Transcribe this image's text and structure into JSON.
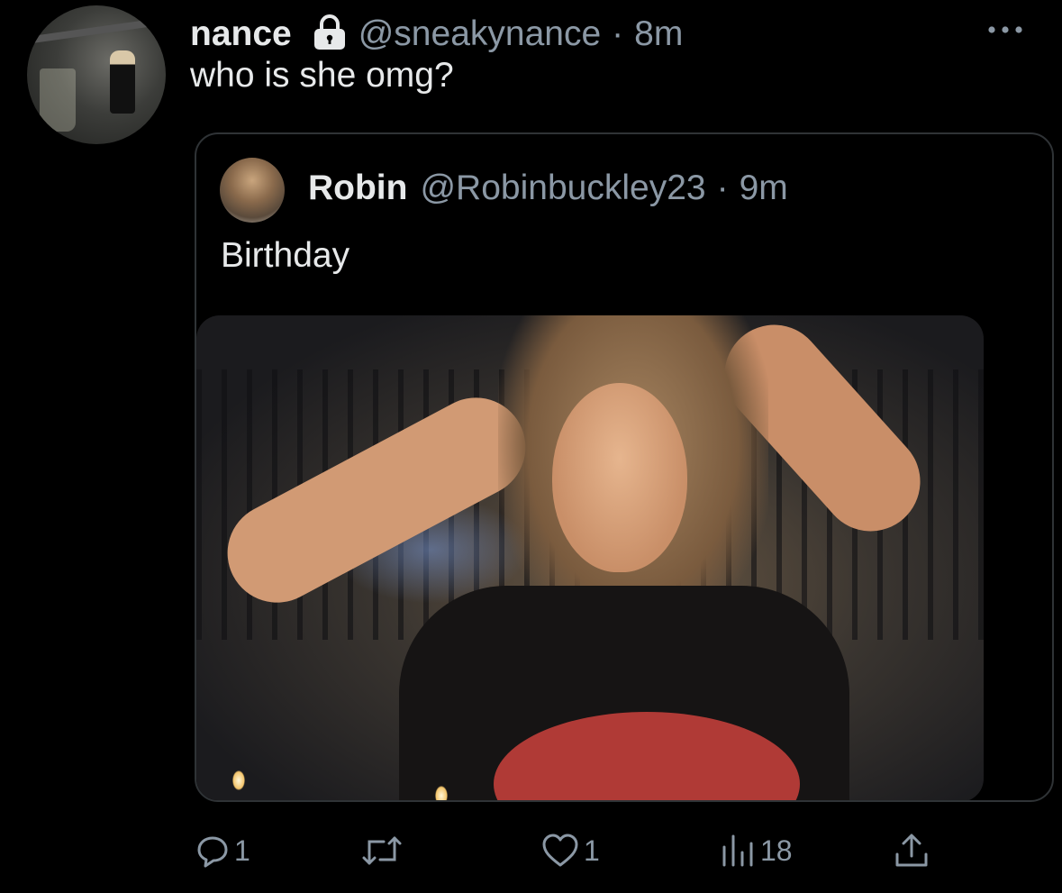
{
  "tweet": {
    "author_name": "nance",
    "author_handle": "@sneakynance",
    "separator": "·",
    "time": "8m",
    "text": "who is she omg?",
    "protected_icon": "lock-icon",
    "menu_icon": "more-icon"
  },
  "quoted_tweet": {
    "author_name": "Robin",
    "author_handle": "@Robinbuckley23",
    "separator": "·",
    "time": "9m",
    "text": "Birthday"
  },
  "actions": {
    "replies": "1",
    "likes": "1",
    "views": "18",
    "reply_icon": "reply-icon",
    "retweet_icon": "retweet-icon",
    "like_icon": "heart-icon",
    "views_icon": "views-chart-icon",
    "share_icon": "share-icon"
  },
  "colors": {
    "background": "#000000",
    "primary_text": "#e7e9ea",
    "secondary_text": "#8b98a5",
    "border": "#2f3336"
  }
}
